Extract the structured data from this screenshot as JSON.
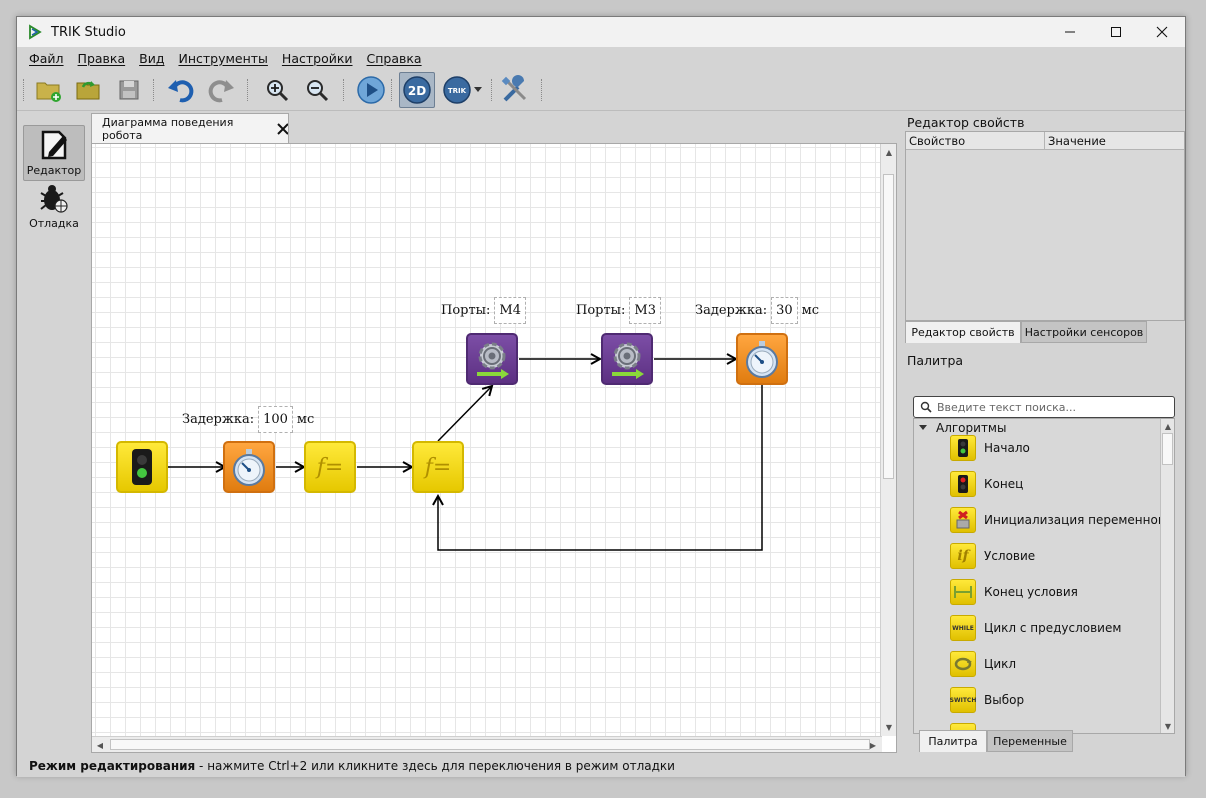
{
  "window": {
    "title": "TRIK Studio"
  },
  "menu": [
    "Файл",
    "Правка",
    "Вид",
    "Инструменты",
    "Настройки",
    "Справка"
  ],
  "toolbar": {
    "mode_2d_label": "2D",
    "trik_label": "TRIK"
  },
  "modes": {
    "editor_label": "Редактор",
    "debug_label": "Отладка"
  },
  "tab": {
    "title": "Диаграмма поведения робота"
  },
  "diagram": {
    "delay1": {
      "label": "Задержка:",
      "value": "100",
      "unit": "мс"
    },
    "motor1": {
      "label": "Порты:",
      "value": "M4"
    },
    "motor2": {
      "label": "Порты:",
      "value": "M3"
    },
    "delay2": {
      "label": "Задержка:",
      "value": "30",
      "unit": "мс"
    },
    "func_symbol": "f="
  },
  "property_editor": {
    "title": "Редактор свойств",
    "col_property": "Свойство",
    "col_value": "Значение",
    "tab_props": "Редактор свойств",
    "tab_sensors": "Настройки сенсоров"
  },
  "palette": {
    "title": "Палитра",
    "search_placeholder": "Введите текст поиска...",
    "group": "Алгоритмы",
    "items": [
      "Начало",
      "Конец",
      "Инициализация переменной",
      "Условие",
      "Конец условия",
      "Цикл с предусловием",
      "Цикл",
      "Выбор"
    ],
    "while_icon_text": "WHILE",
    "switch_icon_text": "SWITCH",
    "tab_palette": "Палитра",
    "tab_vars": "Переменные"
  },
  "status": {
    "bold": "Режим редактирования",
    "rest": " - нажмите Ctrl+2 или кликните здесь для переключения в режим отладки"
  }
}
